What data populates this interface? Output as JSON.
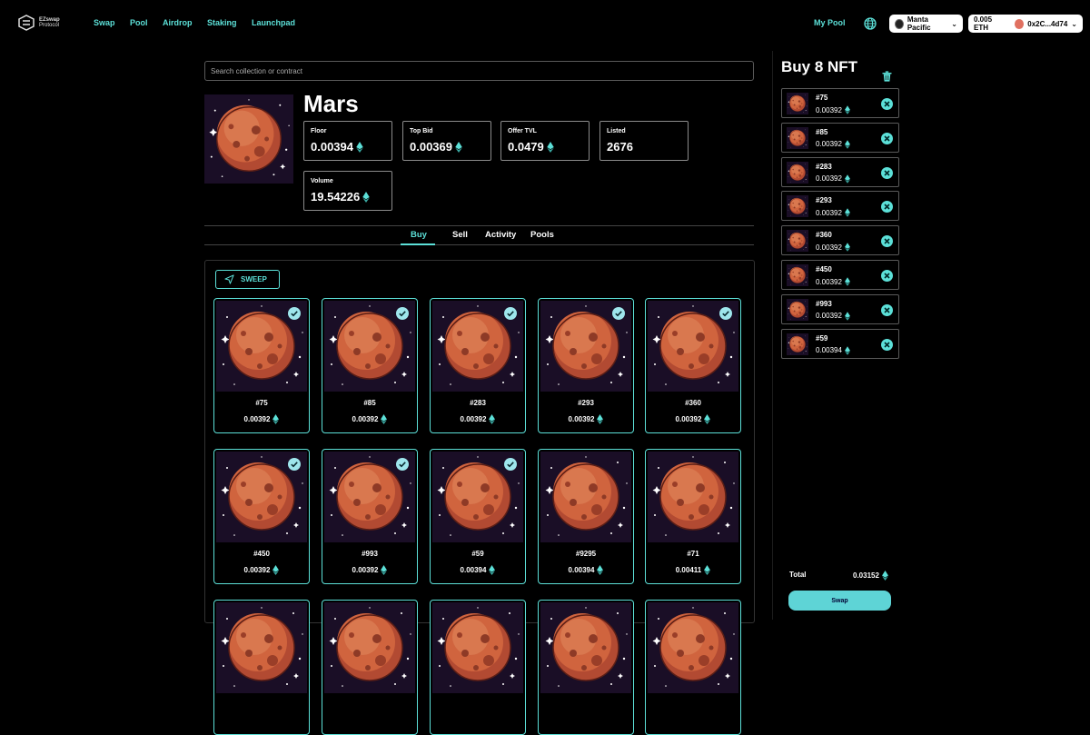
{
  "colors": {
    "accent": "#5ce0d8",
    "background": "#000000",
    "planet": "#c85a3c"
  },
  "nav": {
    "logo_text_1": "EZswap",
    "logo_text_2": "Protocol",
    "links": [
      "Swap",
      "Pool",
      "Airdrop",
      "Staking",
      "Launchpad"
    ],
    "my_pool": "My Pool",
    "network": "Manta Pacific",
    "balance": "0.005 ETH",
    "wallet": "0x2C...4d74"
  },
  "search": {
    "placeholder": "Search collection or contract"
  },
  "collection": {
    "name": "Mars",
    "stats": {
      "floor_label": "Floor",
      "floor": "0.00394",
      "top_bid_label": "Top Bid",
      "top_bid": "0.00369",
      "offer_tvl_label": "Offer TVL",
      "offer_tvl": "0.0479",
      "listed_label": "Listed",
      "listed": "2676",
      "volume_label": "Volume",
      "volume": "19.54226"
    }
  },
  "tabs": {
    "buy": "Buy",
    "sell": "Sell",
    "activity": "Activity",
    "pools": "Pools",
    "active": "Buy"
  },
  "sweep_label": "SWEEP",
  "nfts": [
    {
      "name": "#75",
      "price": "0.00392",
      "selected": true
    },
    {
      "name": "#85",
      "price": "0.00392",
      "selected": true
    },
    {
      "name": "#283",
      "price": "0.00392",
      "selected": true
    },
    {
      "name": "#293",
      "price": "0.00392",
      "selected": true
    },
    {
      "name": "#360",
      "price": "0.00392",
      "selected": true
    },
    {
      "name": "#450",
      "price": "0.00392",
      "selected": true
    },
    {
      "name": "#993",
      "price": "0.00392",
      "selected": true
    },
    {
      "name": "#59",
      "price": "0.00394",
      "selected": true
    },
    {
      "name": "#9295",
      "price": "0.00394",
      "selected": false
    },
    {
      "name": "#71",
      "price": "0.00411",
      "selected": false
    }
  ],
  "cart": {
    "title": "Buy 8 NFT",
    "items": [
      {
        "name": "#75",
        "price": "0.00392"
      },
      {
        "name": "#85",
        "price": "0.00392"
      },
      {
        "name": "#283",
        "price": "0.00392"
      },
      {
        "name": "#293",
        "price": "0.00392"
      },
      {
        "name": "#360",
        "price": "0.00392"
      },
      {
        "name": "#450",
        "price": "0.00392"
      },
      {
        "name": "#993",
        "price": "0.00392"
      },
      {
        "name": "#59",
        "price": "0.00394"
      }
    ],
    "total_label": "Total",
    "total": "0.03152",
    "swap_label": "Swap"
  }
}
